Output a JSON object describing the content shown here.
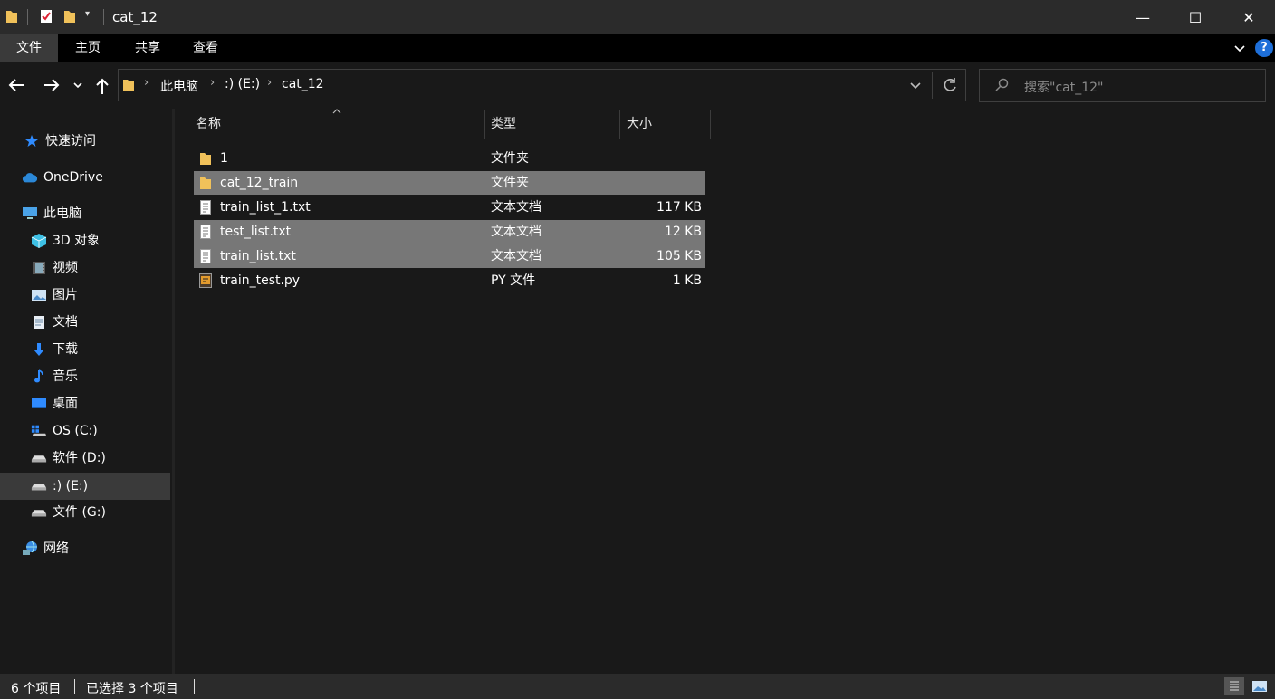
{
  "window": {
    "title": "cat_12",
    "minimize_glyph": "—",
    "maximize_glyph": "☐",
    "close_glyph": "✕"
  },
  "ribbon": {
    "tabs": [
      "文件",
      "主页",
      "共享",
      "查看"
    ]
  },
  "address": {
    "crumbs": [
      "此电脑",
      ":) (E:)",
      "cat_12"
    ]
  },
  "search": {
    "placeholder": "搜索\"cat_12\""
  },
  "sidebar": {
    "items": [
      {
        "label": "快速访问",
        "icon": "star-icon"
      },
      {
        "label": "OneDrive",
        "icon": "cloud-icon"
      },
      {
        "label": "此电脑",
        "icon": "computer-icon"
      },
      {
        "label": "3D 对象",
        "icon": "cube-icon"
      },
      {
        "label": "视频",
        "icon": "film-icon"
      },
      {
        "label": "图片",
        "icon": "picture-icon"
      },
      {
        "label": "文档",
        "icon": "document-icon"
      },
      {
        "label": "下载",
        "icon": "download-icon"
      },
      {
        "label": "音乐",
        "icon": "music-icon"
      },
      {
        "label": "桌面",
        "icon": "desktop-icon"
      },
      {
        "label": "OS (C:)",
        "icon": "windows-drive-icon"
      },
      {
        "label": "软件 (D:)",
        "icon": "drive-icon"
      },
      {
        "label": ":) (E:)",
        "icon": "drive-icon"
      },
      {
        "label": "文件 (G:)",
        "icon": "drive-icon"
      },
      {
        "label": "网络",
        "icon": "network-icon"
      }
    ]
  },
  "columns": {
    "name": "名称",
    "type": "类型",
    "size": "大小"
  },
  "files": [
    {
      "name": "1",
      "type": "文件夹",
      "size": "",
      "icon": "folder-icon",
      "selected": false
    },
    {
      "name": "cat_12_train",
      "type": "文件夹",
      "size": "",
      "icon": "folder-icon",
      "selected": true
    },
    {
      "name": "train_list_1.txt",
      "type": "文本文档",
      "size": "117 KB",
      "icon": "text-file-icon",
      "selected": false
    },
    {
      "name": "test_list.txt",
      "type": "文本文档",
      "size": "12 KB",
      "icon": "text-file-icon",
      "selected": true
    },
    {
      "name": "train_list.txt",
      "type": "文本文档",
      "size": "105 KB",
      "icon": "text-file-icon",
      "selected": true
    },
    {
      "name": "train_test.py",
      "type": "PY 文件",
      "size": "1 KB",
      "icon": "python-file-icon",
      "selected": false
    }
  ],
  "status": {
    "item_count": "6 个项目",
    "selected_count": "已选择 3 个项目"
  },
  "colors": {
    "background": "#191919",
    "selection": "#777777",
    "folder": "#f0c15a",
    "help": "#1e6fd9"
  }
}
